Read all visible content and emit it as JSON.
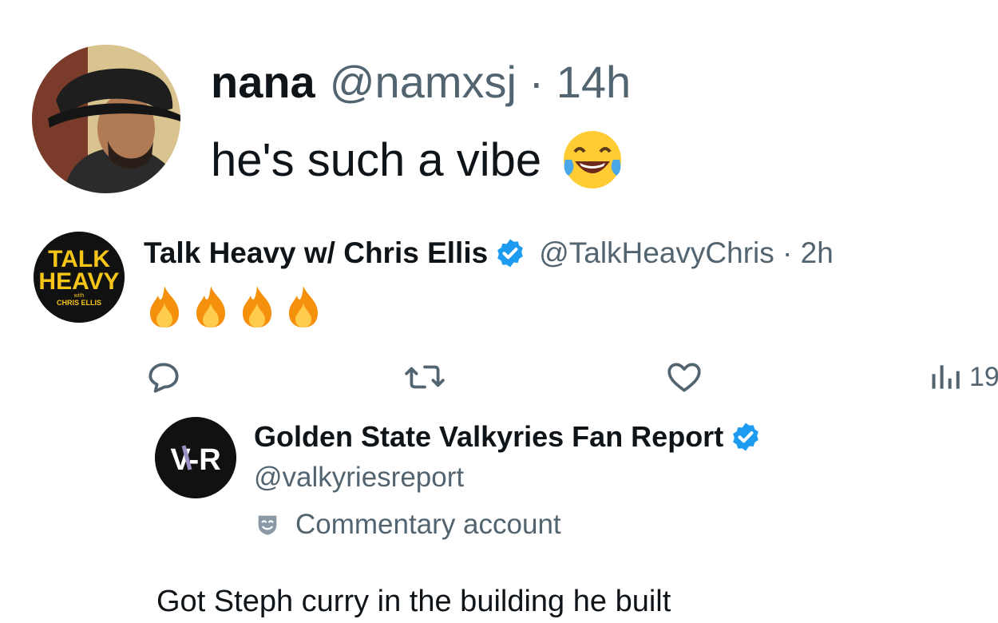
{
  "post1": {
    "name": "nana",
    "meta": "@namxsj · 14h",
    "text": "he's such a vibe",
    "emoji": "face-with-tears-of-joy"
  },
  "post2": {
    "avatar_lines": [
      "TALK",
      "HEAVY",
      "with",
      "CHRIS ELLIS"
    ],
    "name": "Talk Heavy w/ Chris Ellis",
    "meta": "@TalkHeavyChris · 2h",
    "emoji": [
      "fire",
      "fire",
      "fire",
      "fire"
    ],
    "verified_color": "#1d9bf0"
  },
  "actions": {
    "reply_icon": "reply-icon",
    "retweet_icon": "retweet-icon",
    "like_icon": "heart-icon",
    "views_icon": "views-icon",
    "views_count": "19"
  },
  "quote": {
    "avatar_text": "V-R",
    "name": "Golden State Valkyries Fan Report",
    "handle": "@valkyriesreport",
    "label": "Commentary account",
    "text": "Got Steph curry in the building he built"
  },
  "colors": {
    "text_primary": "#0f1419",
    "text_secondary": "#536471",
    "brand_blue": "#1d9bf0",
    "valkyries_purple": "#9b8fc4"
  }
}
